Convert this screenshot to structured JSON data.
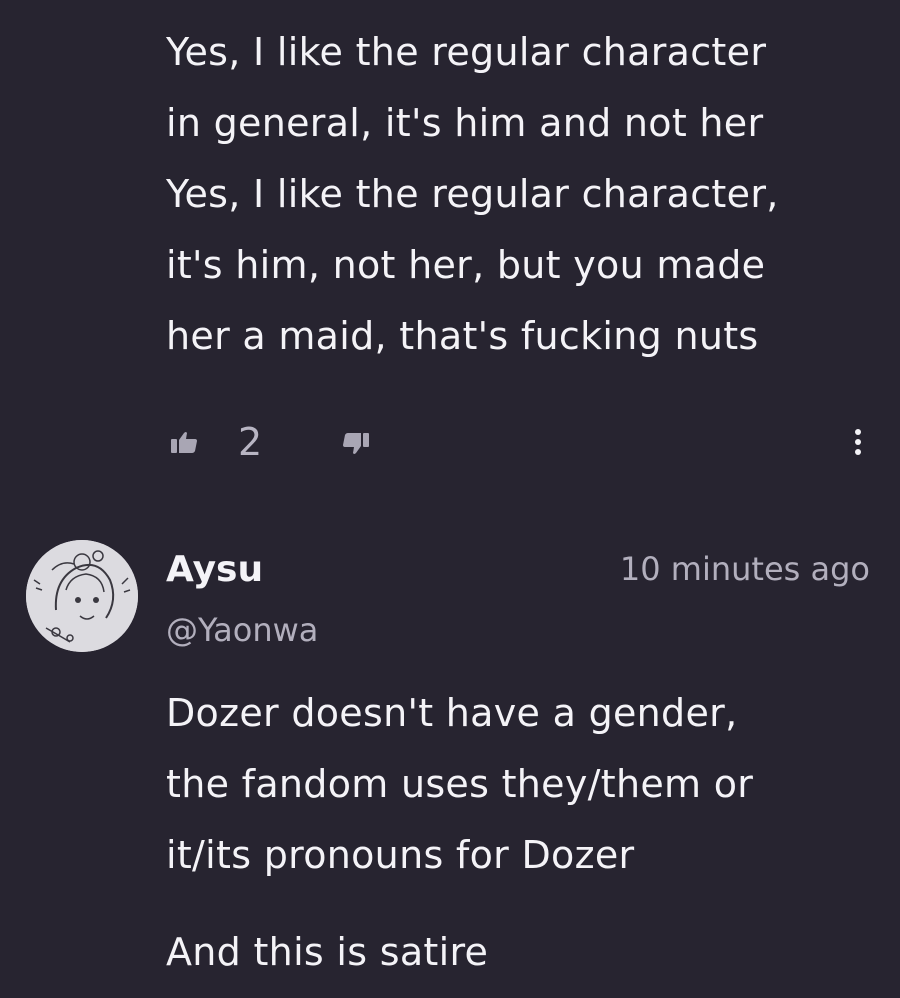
{
  "previous_comment": {
    "lines": [
      "Yes, I like the regular character",
      "in general, it's him and not her",
      "Yes, I like the regular character,",
      "it's him, not her, but you made",
      "her a maid, that's fucking nuts"
    ],
    "actions": {
      "like_icon": "thumbs-up-icon",
      "like_count": "2",
      "dislike_icon": "thumbs-down-icon",
      "more_icon": "vertical-ellipsis-icon"
    }
  },
  "reply": {
    "author_name": "Aysu",
    "author_handle": "@Yaonwa",
    "timestamp": "10 minutes ago",
    "paragraph1_lines": [
      "Dozer doesn't have a gender,",
      "the fandom uses they/them or",
      "it/its pronouns for Dozer"
    ],
    "paragraph2": "And this is satire"
  },
  "colors": {
    "background": "#272430",
    "text": "#f4f3f7",
    "muted": "#b2afbd",
    "icon": "#a9a6b4"
  }
}
